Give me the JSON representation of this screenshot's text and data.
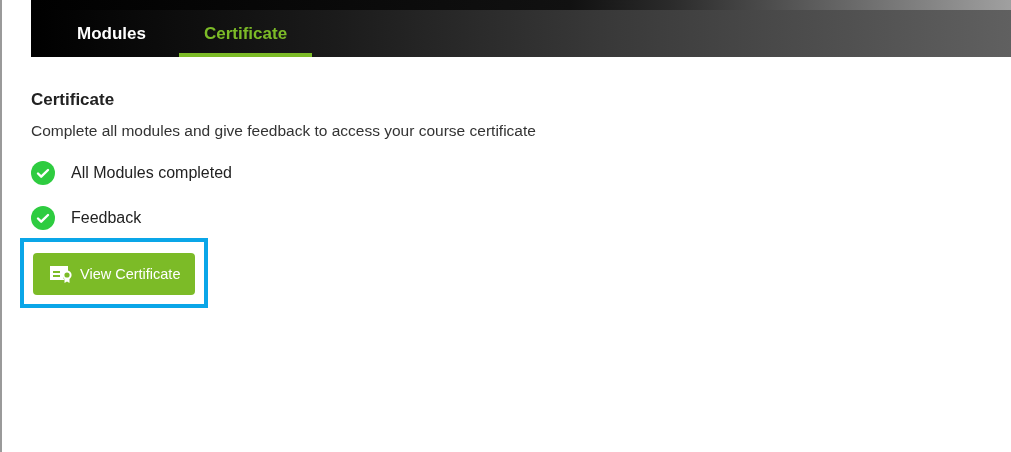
{
  "tabs": [
    {
      "label": "Modules",
      "selected": false
    },
    {
      "label": "Certificate",
      "selected": true
    }
  ],
  "section": {
    "title": "Certificate",
    "description": "Complete all modules and give feedback to access your course certificate"
  },
  "requirements": [
    {
      "label": "All Modules completed",
      "done": true
    },
    {
      "label": "Feedback",
      "done": true
    }
  ],
  "action": {
    "label": "View Certificate",
    "highlighted": true
  }
}
